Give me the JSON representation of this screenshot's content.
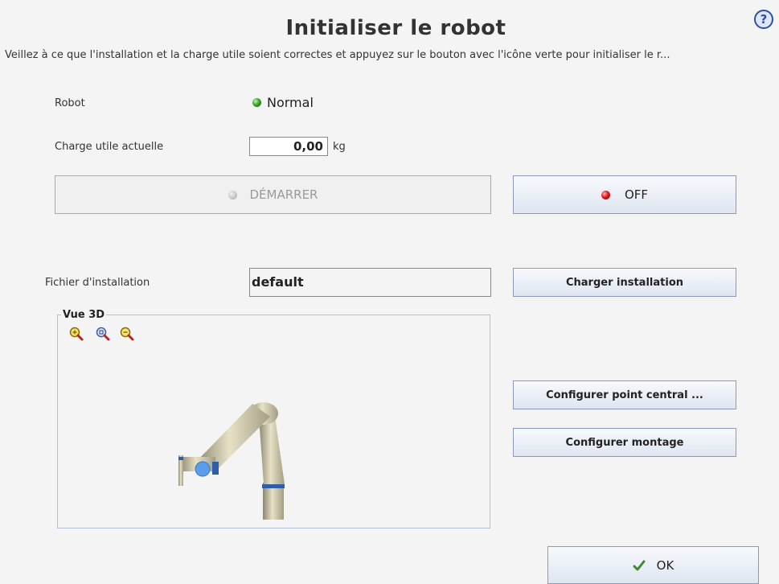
{
  "header": {
    "title": "Initialiser le robot",
    "help_icon": "?",
    "subtitle": "Veillez à ce que l'installation et la charge utile soient correctes et appuyez sur le bouton avec l'icône verte pour initialiser le r..."
  },
  "robot": {
    "label": "Robot",
    "status": "Normal",
    "status_color": "#3da32a"
  },
  "payload": {
    "label": "Charge utile actuelle",
    "value": "0,00",
    "unit": "kg"
  },
  "power": {
    "start_label": "DÉMARRER",
    "start_led_color": "#c8c8c8",
    "off_label": "OFF",
    "off_led_color": "#e01919"
  },
  "installation": {
    "label": "Fichier d'installation",
    "value": "default",
    "load_button": "Charger installation"
  },
  "view3d": {
    "title": "Vue 3D",
    "zoom_icons": [
      "zoom-in-icon",
      "zoom-reset-icon",
      "zoom-out-icon"
    ]
  },
  "buttons": {
    "tcp": "Configurer point central ...",
    "mount": "Configurer montage",
    "ok": "OK"
  }
}
